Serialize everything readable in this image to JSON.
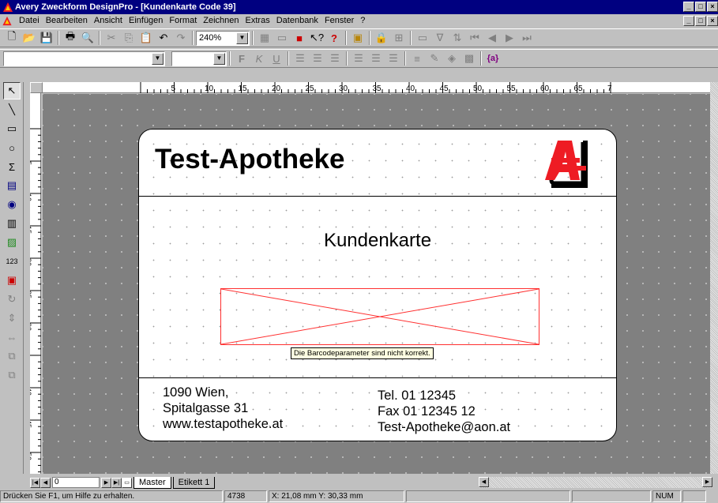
{
  "window": {
    "title": "Avery Zweckform DesignPro - [Kundenkarte Code 39]",
    "buttons": [
      "_",
      "□",
      "×"
    ]
  },
  "menubar": {
    "items": [
      "Datei",
      "Bearbeiten",
      "Ansicht",
      "Einfügen",
      "Format",
      "Zeichnen",
      "Extras",
      "Datenbank",
      "Fenster",
      "?"
    ]
  },
  "toolbar": {
    "zoom_value": "240%",
    "font_name_value": "",
    "font_size_value": "",
    "bold_label": "F",
    "italic_label": "K",
    "underline_label": "U",
    "field_label": "{a}"
  },
  "ruler": {
    "h_labels": [
      "5",
      "10",
      "15",
      "20",
      "25",
      "30",
      "35",
      "40",
      "45",
      "50",
      "55",
      "60",
      "65",
      "7"
    ],
    "v_labels": [
      "5",
      "10",
      "15",
      "20",
      "25",
      "30",
      "40",
      "45",
      "50"
    ]
  },
  "card": {
    "title": "Test-Apotheke",
    "subtitle": "Kundenkarte",
    "barcode_error": "Die Barcodeparameter sind nicht korrekt.",
    "address": [
      "1090 Wien,",
      "Spitalgasse 31",
      "www.testapotheke.at"
    ],
    "contact": [
      "Tel. 01 12345",
      "Fax 01 12345 12",
      "Test-Apotheke@aon.at"
    ],
    "logo_color": "#ee1c24"
  },
  "tabs": {
    "page_field": "0",
    "items": [
      "Master",
      "Etikett 1"
    ]
  },
  "status": {
    "help": "Drücken Sie F1, um Hilfe zu erhalten.",
    "count": "4738",
    "coords": "X: 21,08 mm  Y: 30,33 mm",
    "num": "NUM"
  }
}
